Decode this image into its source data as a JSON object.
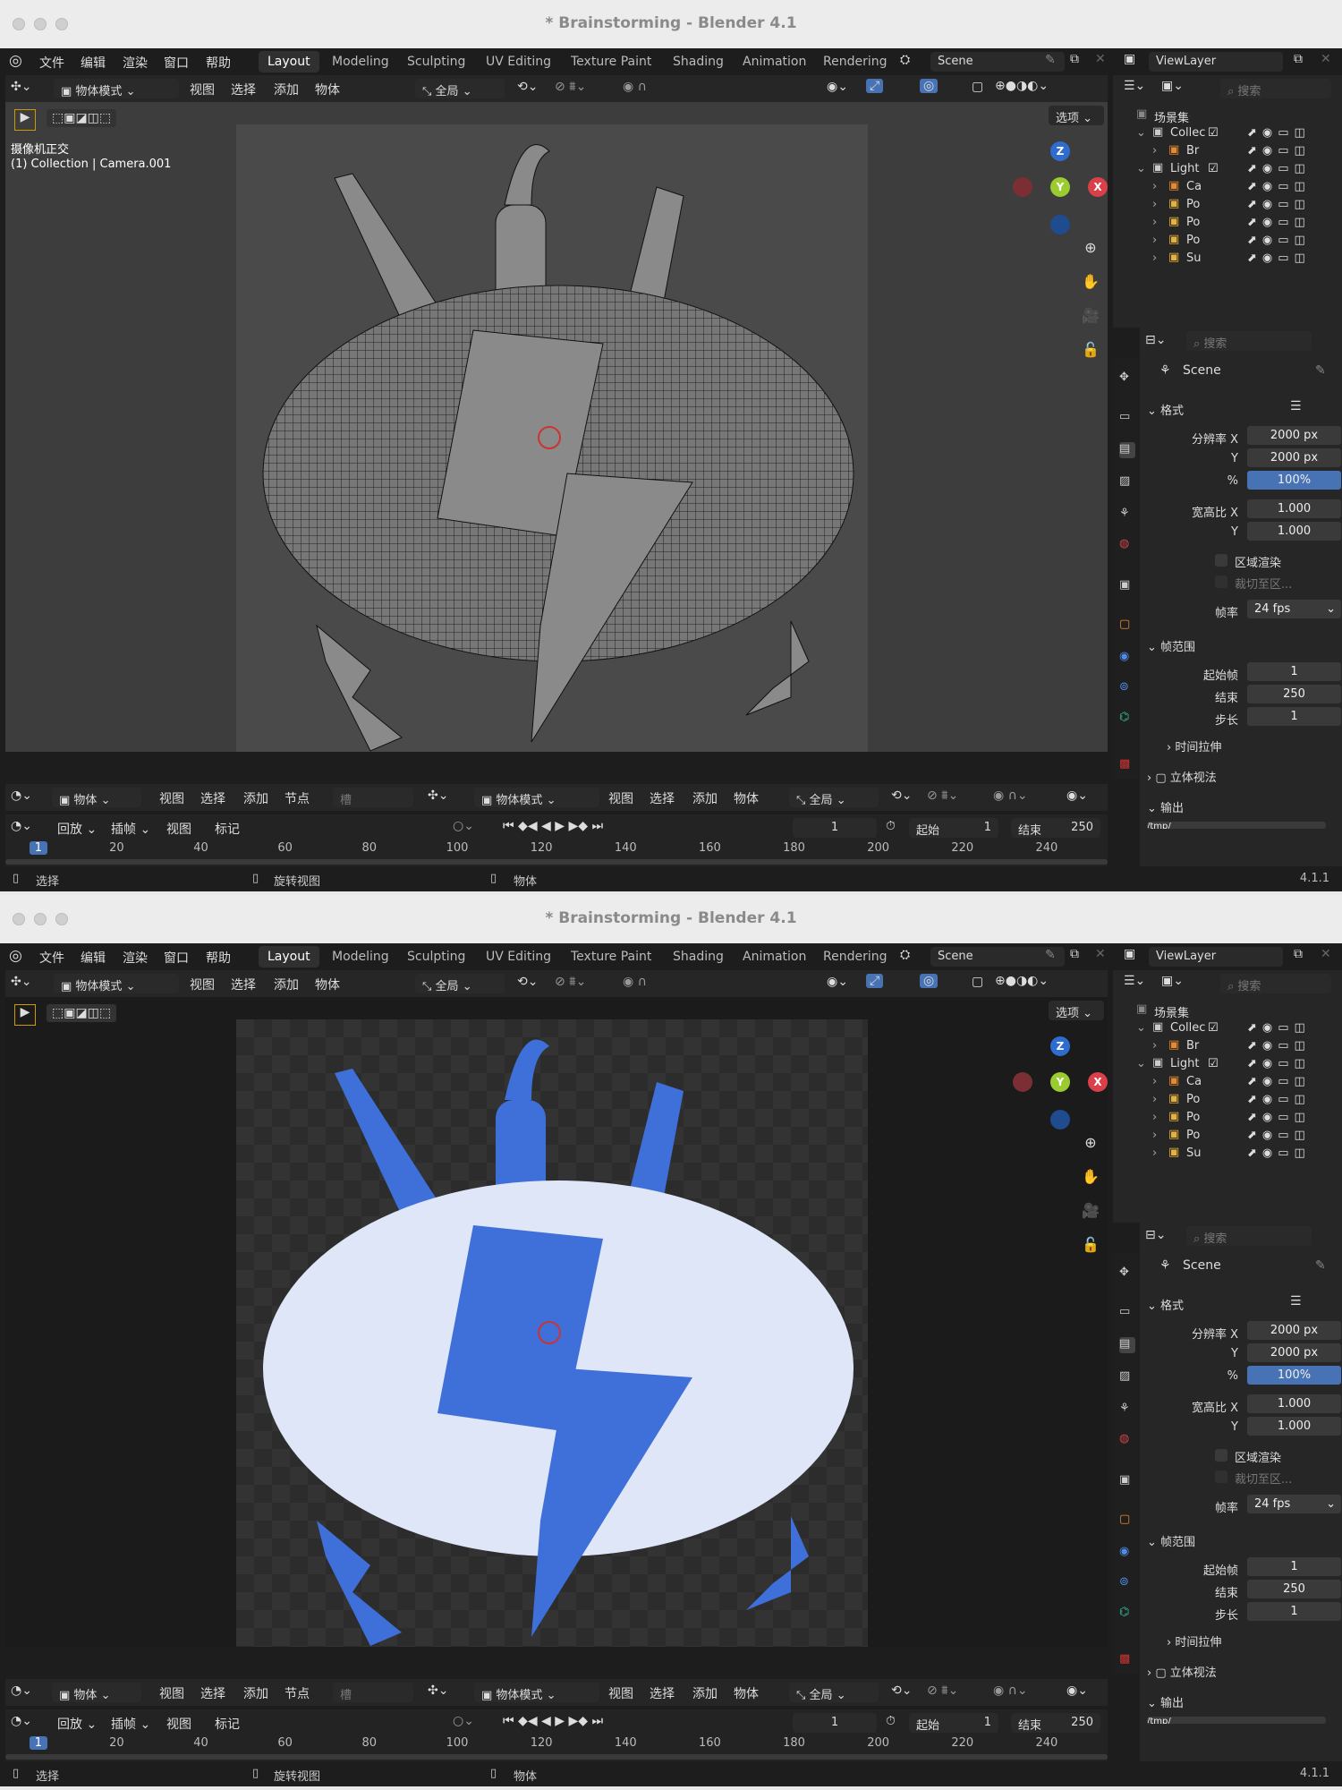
{
  "window_title": "* Brainstorming - Blender 4.1",
  "menus": [
    "文件",
    "编辑",
    "渲染",
    "窗口",
    "帮助"
  ],
  "workspaces": [
    "Layout",
    "Modeling",
    "Sculpting",
    "UV Editing",
    "Texture Paint",
    "Shading",
    "Animation",
    "Rendering"
  ],
  "scene_name": "Scene",
  "view_layer": "ViewLayer",
  "viewport_header": {
    "mode": "物体模式",
    "menu": [
      "视图",
      "选择",
      "添加",
      "物体"
    ],
    "transform": "全局",
    "options": "选项"
  },
  "viewport_overlay": {
    "line1": "摄像机正交",
    "line2": "(1) Collection | Camera.001"
  },
  "gizmo": {
    "z": "Z",
    "y": "Y",
    "x": "X"
  },
  "node_bar": {
    "left_mode": "物体",
    "left_menu": [
      "视图",
      "选择",
      "添加",
      "节点"
    ],
    "slot": "槽",
    "mode": "物体模式",
    "right_menu": [
      "视图",
      "选择",
      "添加",
      "物体"
    ],
    "transform": "全局"
  },
  "timeline": {
    "menu": [
      "回放",
      "插帧",
      "视图",
      "标记"
    ],
    "current_frame": "1",
    "start_label": "起始",
    "start": "1",
    "end_label": "结束",
    "end": "250",
    "ticks": [
      "1",
      "20",
      "40",
      "60",
      "80",
      "100",
      "120",
      "140",
      "160",
      "180",
      "200",
      "220",
      "240"
    ]
  },
  "status_bar": {
    "select": "选择",
    "rotate": "旋转视图",
    "object": "物体",
    "version": "4.1.1"
  },
  "outliner": {
    "search_placeholder": "搜索",
    "root": "场景集合",
    "rows": [
      "Collec",
      "Br",
      "Light",
      "Ca",
      "Po",
      "Po",
      "Po",
      "Su"
    ]
  },
  "properties": {
    "search_placeholder": "搜索",
    "scene": "Scene",
    "format_section": "格式",
    "res_x_label": "分辨率 X",
    "res_x": "2000 px",
    "res_y_label": "Y",
    "res_y": "2000 px",
    "pct_label": "%",
    "pct": "100%",
    "aspect_x_label": "宽高比 X",
    "aspect_x": "1.000",
    "aspect_y_label": "Y",
    "aspect_y": "1.000",
    "region_render": "区域渲染",
    "crop": "裁切至区...",
    "fps_label": "帧率",
    "fps": "24 fps",
    "frame_range_section": "帧范围",
    "frame_start_label": "起始帧",
    "frame_start": "1",
    "frame_end_label": "结束",
    "frame_end": "250",
    "frame_step_label": "步长",
    "frame_step": "1",
    "time_stretch": "时间拉伸",
    "stereoscopy": "立体视法",
    "output_section": "输出",
    "output_path": "/tmp/"
  },
  "colors": {
    "accent": "#4772b3",
    "model_blue": "#3f6fd8",
    "brain_white": "#dfe6f7"
  }
}
